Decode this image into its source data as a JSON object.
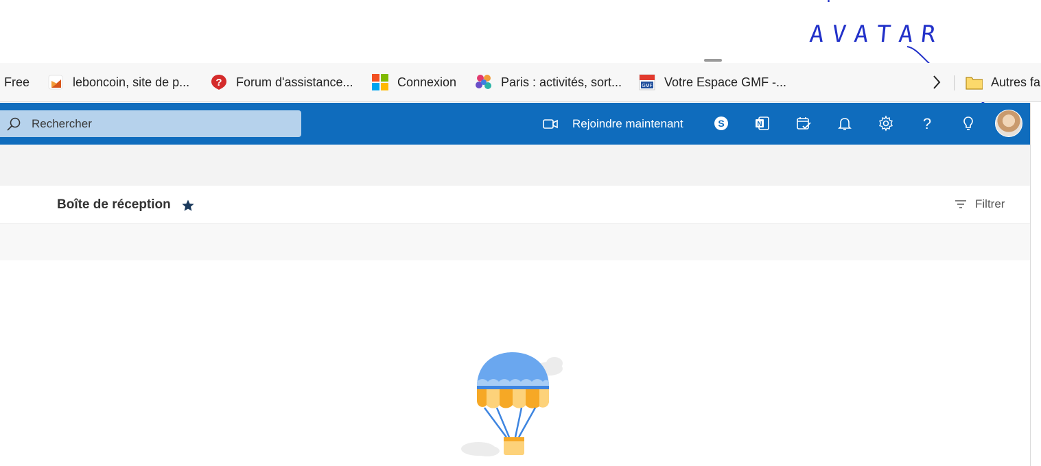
{
  "annotation": {
    "text": "AVATAR",
    "color": "#2231c9"
  },
  "bookmarks": {
    "items": [
      {
        "label": "Free",
        "icon": "none"
      },
      {
        "label": "leboncoin, site de p...",
        "icon": "leboncoin-icon"
      },
      {
        "label": "Forum d'assistance...",
        "icon": "help-balloon-icon"
      },
      {
        "label": "Connexion",
        "icon": "microsoft-logo-icon"
      },
      {
        "label": "Paris : activités, sort...",
        "icon": "paris-flower-icon"
      },
      {
        "label": "Votre Espace GMF -...",
        "icon": "gmf-icon"
      }
    ],
    "more_icon": "chevron-right-icon",
    "other_folder": {
      "label": "Autres fa",
      "icon": "folder-icon"
    }
  },
  "header": {
    "background": "#0f6cbd",
    "search_placeholder": "Rechercher",
    "join_label": "Rejoindre maintenant",
    "icons": [
      "skype-icon",
      "onenote-icon",
      "calendar-check-icon",
      "bell-icon",
      "gear-icon",
      "help-icon",
      "lightbulb-icon"
    ]
  },
  "inbox": {
    "title": "Boîte de réception",
    "filter_label": "Filtrer"
  }
}
